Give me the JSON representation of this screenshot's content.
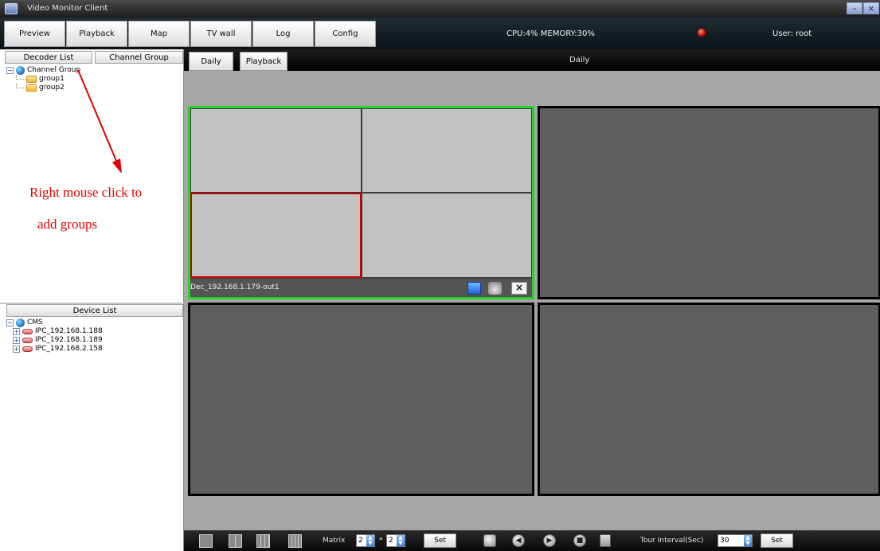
{
  "window": {
    "title": "Video Monitor Client",
    "min_label": "–",
    "close_label": "×"
  },
  "topnav": {
    "buttons": [
      "Preview",
      "Playback",
      "Map",
      "TV wall",
      "Log",
      "Config"
    ],
    "status": "CPU:4%  MEMORY:30%",
    "user": "User: root"
  },
  "left": {
    "tabs": [
      "Decoder List",
      "Channel Group"
    ],
    "channel_tree": {
      "root": "Channel Group",
      "children": [
        "group1",
        "group2"
      ]
    },
    "device_header": "Device List",
    "device_tree": {
      "root": "CMS",
      "children": [
        "IPC_192.168.1.188",
        "IPC_192.168.1.189",
        "IPC_192.168.2.158"
      ]
    },
    "annotation": {
      "line1": "Right mouse click to",
      "line2": "add groups",
      "color": "#e00000"
    }
  },
  "right": {
    "subtabs": [
      "Daily",
      "Playback"
    ],
    "title": "Daily",
    "screen1_label": "Dec_192.168.1.179-out1",
    "active_border_color": "#29d429",
    "selected_cell_color": "#c40000"
  },
  "toolbar": {
    "matrix_label": "Matrix",
    "matrix_rows": "2",
    "matrix_sep": "*",
    "matrix_cols": "2",
    "set_label": "Set",
    "tour_label": "Tour Interval(Sec)",
    "tour_value": "30",
    "tour_set_label": "Set"
  }
}
